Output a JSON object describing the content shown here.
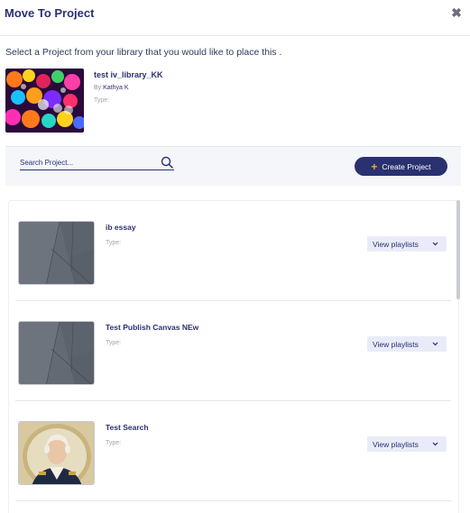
{
  "dialog": {
    "title": "Move To Project",
    "close_glyph": "✖",
    "instruction": "Select a Project from your library that you would like to place this ."
  },
  "source_item": {
    "name": "test iv_library_KK",
    "by_label": "By:",
    "author": "Kathya K",
    "type_label": "Type:"
  },
  "search": {
    "placeholder": "Search Project...",
    "value": ""
  },
  "create_button": {
    "plus": "+",
    "label": "Create Project"
  },
  "projects": [
    {
      "name": "ib essay",
      "type_label": "Type:",
      "button_label": "View playlists",
      "thumbnail": "gray-geometric"
    },
    {
      "name": "Test Publish Canvas NEw",
      "type_label": "Type:",
      "button_label": "View playlists",
      "thumbnail": "gray-geometric"
    },
    {
      "name": "Test Search",
      "type_label": "Type:",
      "button_label": "View playlists",
      "thumbnail": "portrait"
    }
  ],
  "colors": {
    "brand": "#2a3170",
    "accent": "#f5a623",
    "button_bg": "#e9ecf8"
  }
}
